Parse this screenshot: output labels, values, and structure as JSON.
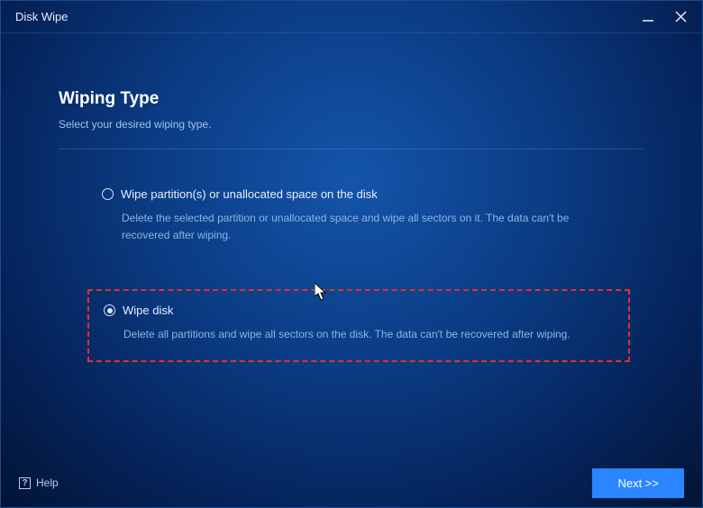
{
  "window": {
    "title": "Disk Wipe"
  },
  "page": {
    "title": "Wiping Type",
    "subtitle": "Select your desired wiping type."
  },
  "options": [
    {
      "label": "Wipe partition(s) or unallocated space on the disk",
      "description": "Delete the selected partition or unallocated space and wipe all sectors on it. The data can't be recovered after wiping.",
      "selected": false,
      "highlighted": false
    },
    {
      "label": "Wipe disk",
      "description": "Delete all partitions and wipe all sectors on the disk. The data can't be recovered after wiping.",
      "selected": true,
      "highlighted": true
    }
  ],
  "footer": {
    "help": "Help",
    "next": "Next >>"
  }
}
